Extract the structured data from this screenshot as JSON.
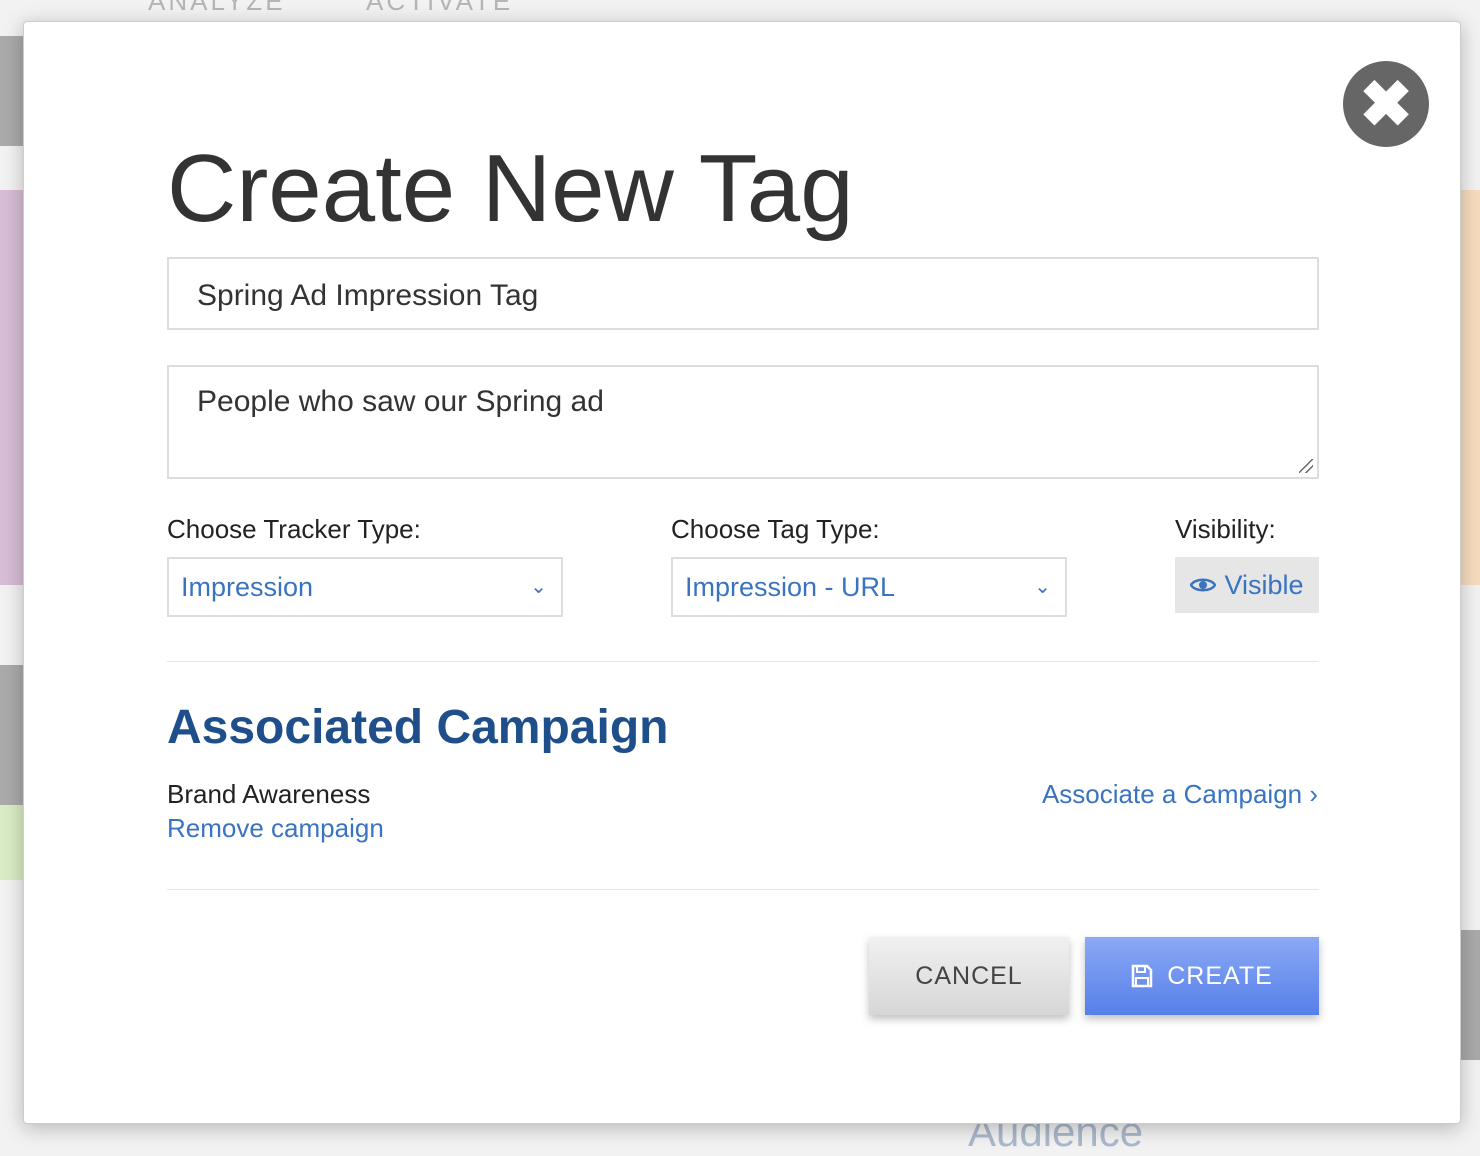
{
  "background": {
    "nav": [
      "ANALYZE",
      "ACTIVATE"
    ],
    "audience_label": "Audience"
  },
  "modal": {
    "title": "Create New Tag",
    "close_icon": "close-circle-icon",
    "name_value": "Spring Ad Impression Tag",
    "description_value": "People who saw our Spring ad",
    "tracker_label": "Choose Tracker Type:",
    "tracker_value": "Impression",
    "tag_type_label": "Choose Tag Type:",
    "tag_type_value": "Impression - URL",
    "visibility_label": "Visibility:",
    "visibility_value": "Visible",
    "campaign_heading": "Associated Campaign",
    "campaign_name": "Brand Awareness",
    "remove_campaign": "Remove campaign",
    "associate_campaign": "Associate a Campaign ›",
    "cancel_label": "CANCEL",
    "create_label": "CREATE",
    "accent": "#3a74c0",
    "primary": "#5c84ea"
  }
}
